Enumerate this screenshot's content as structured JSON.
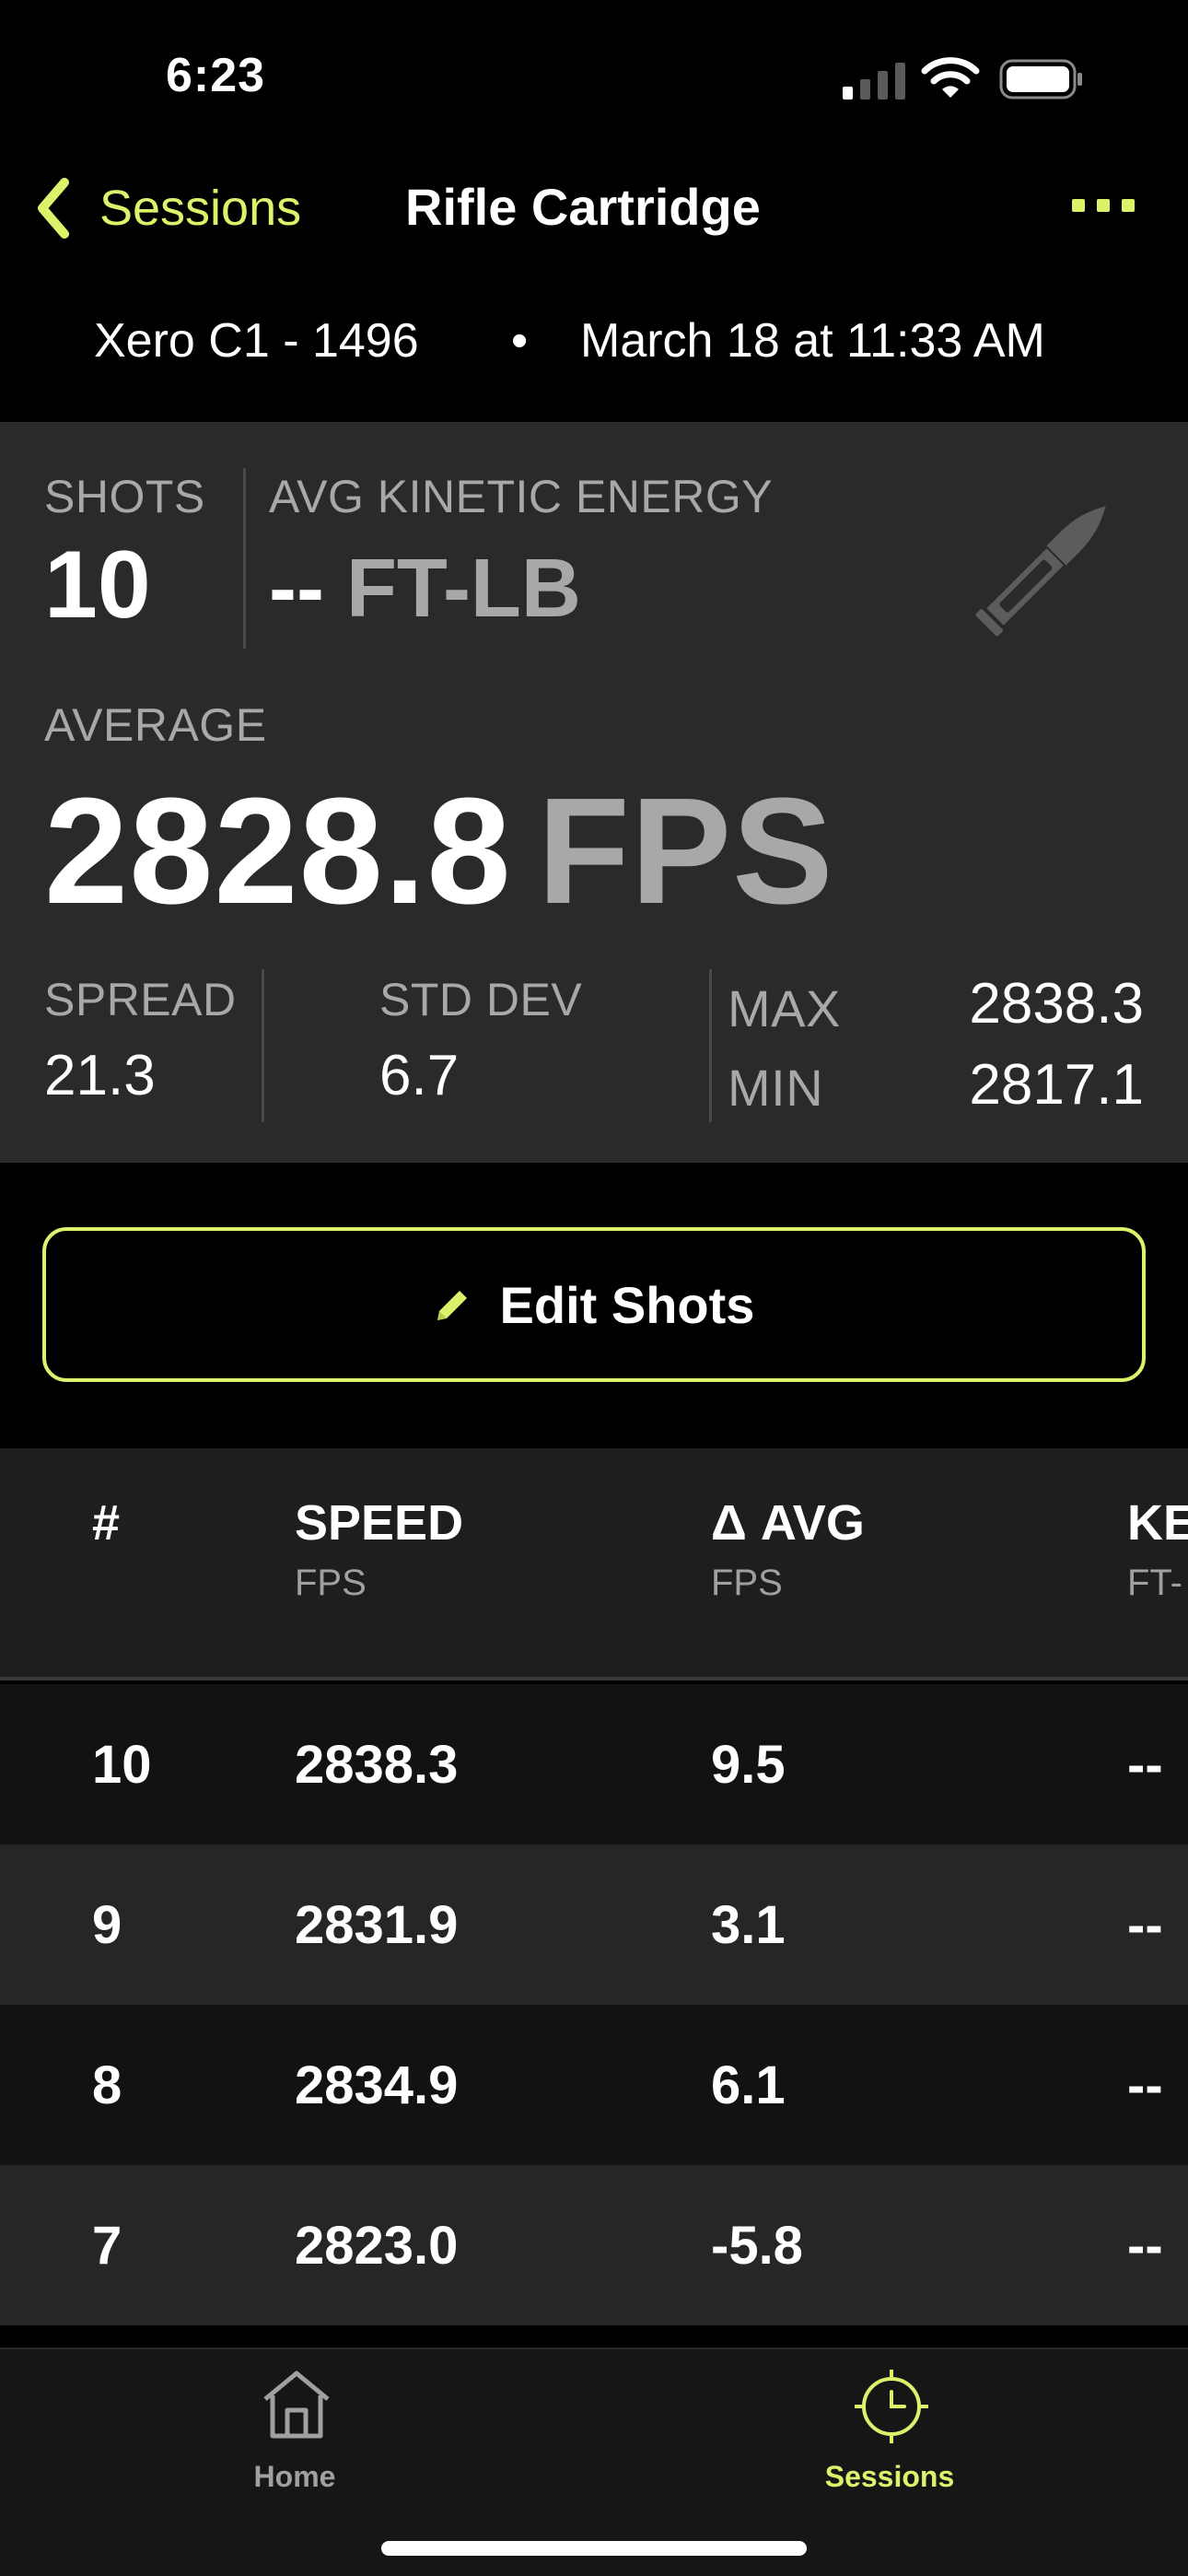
{
  "status": {
    "time": "6:23"
  },
  "nav": {
    "back_label": "Sessions",
    "title": "Rifle Cartridge"
  },
  "subtitle": {
    "device": "Xero C1 - 1496",
    "separator": "•",
    "date": "March 18 at 11:33 AM"
  },
  "stats": {
    "shots_label": "SHOTS",
    "shots_value": "10",
    "ke_label": "AVG KINETIC ENERGY",
    "ke_value": "--",
    "ke_unit": "FT-LB",
    "avg_label": "AVERAGE",
    "avg_value": "2828.8",
    "avg_unit": "FPS",
    "spread_label": "SPREAD",
    "spread_value": "21.3",
    "std_label": "STD DEV",
    "std_value": "6.7",
    "max_label": "MAX",
    "max_value": "2838.3",
    "min_label": "MIN",
    "min_value": "2817.1"
  },
  "edit": {
    "label": "Edit Shots"
  },
  "table": {
    "headers": [
      {
        "title": "#",
        "unit": ""
      },
      {
        "title": "SPEED",
        "unit": "FPS"
      },
      {
        "title": "Δ AVG",
        "unit": "FPS"
      },
      {
        "title": "KE",
        "unit": "FT-"
      }
    ],
    "rows": [
      {
        "num": "10",
        "speed": "2838.3",
        "delta": "9.5",
        "ke": "--"
      },
      {
        "num": "9",
        "speed": "2831.9",
        "delta": "3.1",
        "ke": "--"
      },
      {
        "num": "8",
        "speed": "2834.9",
        "delta": "6.1",
        "ke": "--"
      },
      {
        "num": "7",
        "speed": "2823.0",
        "delta": "-5.8",
        "ke": "--"
      }
    ]
  },
  "tabs": [
    {
      "label": "Home",
      "active": false
    },
    {
      "label": "Sessions",
      "active": true
    }
  ],
  "colors": {
    "accent": "#DDF26B",
    "panel": "#2A2A2A",
    "muted": "#A8A8A8"
  }
}
